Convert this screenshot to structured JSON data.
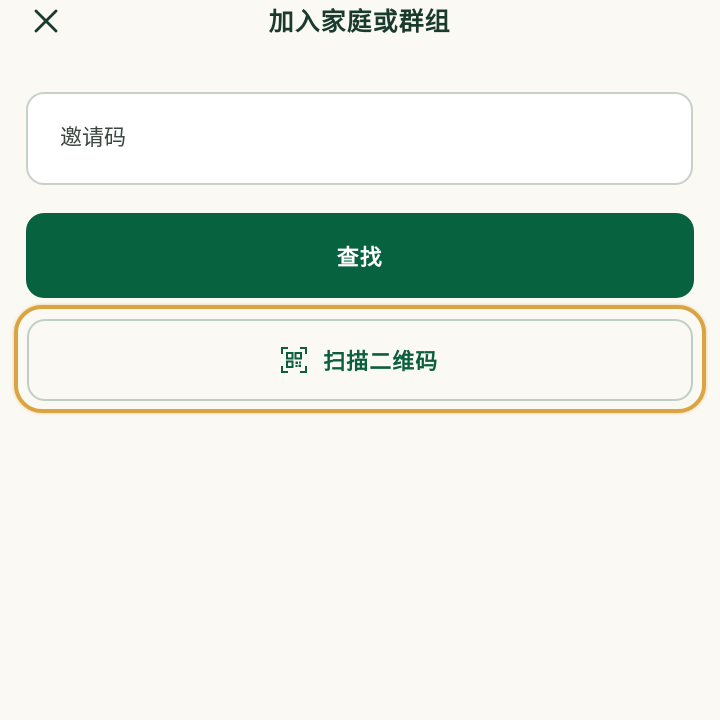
{
  "header": {
    "title": "加入家庭或群组",
    "close_icon": "close-icon"
  },
  "form": {
    "invite_code": {
      "value": "",
      "placeholder": "邀请码"
    },
    "find_label": "查找",
    "scan_label": "扫描二维码",
    "scan_icon": "qr-code-icon"
  },
  "colors": {
    "background": "#FBF9F3",
    "primary": "#07623F",
    "title": "#1B3A2E",
    "input_border": "#C6D2C8",
    "focus_ring": "#D9A441"
  }
}
